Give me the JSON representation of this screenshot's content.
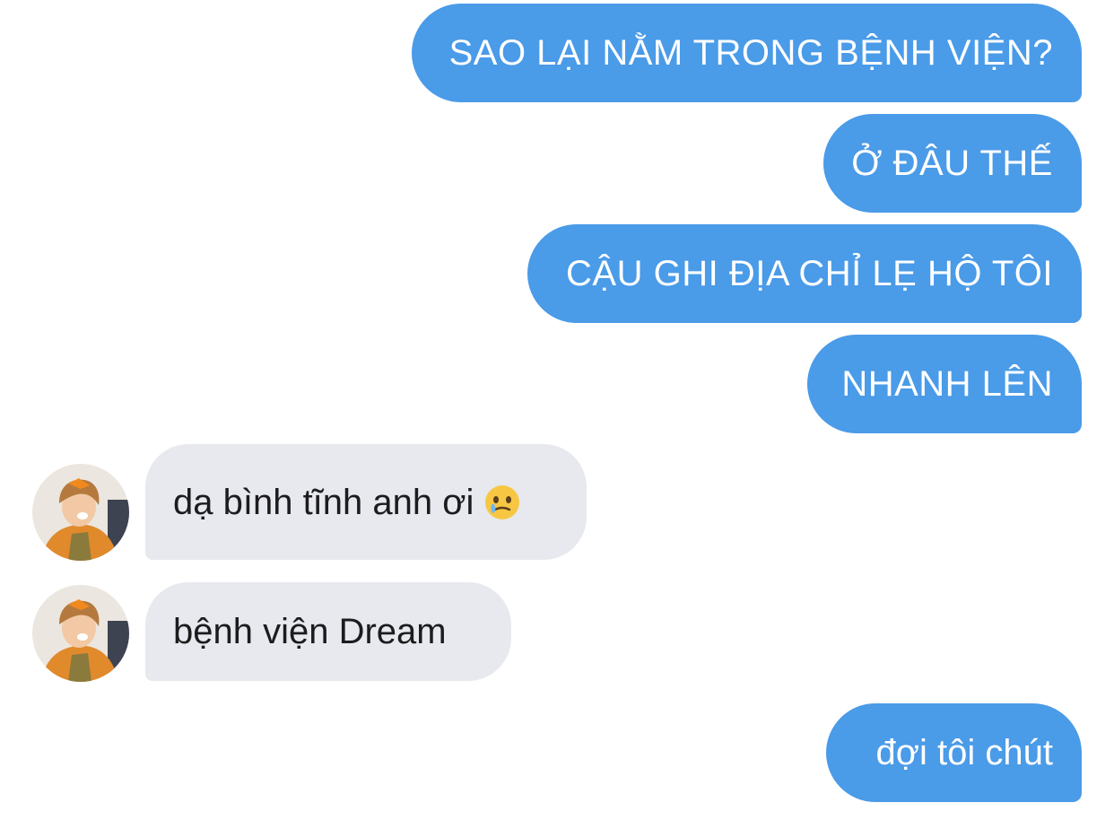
{
  "messages": [
    {
      "direction": "outgoing",
      "text": "SAO LẠI NẰM TRONG BỆNH VIỆN?"
    },
    {
      "direction": "outgoing",
      "text": "Ở ĐÂU THẾ"
    },
    {
      "direction": "outgoing",
      "text": "CẬU GHI ĐỊA CHỈ LẸ HỘ TÔI"
    },
    {
      "direction": "outgoing",
      "text": "NHANH LÊN"
    },
    {
      "direction": "incoming",
      "text": "dạ bình tĩnh anh ơi",
      "emoji": "face-holding-back-tears-icon"
    },
    {
      "direction": "incoming",
      "text": "bệnh viện Dream"
    },
    {
      "direction": "outgoing",
      "text": "đợi tôi chút"
    }
  ],
  "colors": {
    "outgoing_bubble": "#4a9be8",
    "incoming_bubble": "#e7e9ee",
    "outgoing_text": "#ffffff",
    "incoming_text": "#1c1c1e"
  }
}
